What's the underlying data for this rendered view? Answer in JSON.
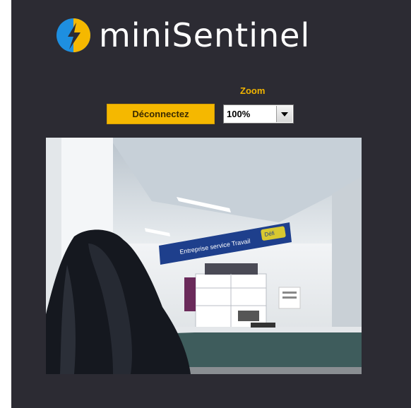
{
  "app": {
    "name": "miniSentinel"
  },
  "controls": {
    "disconnect_label": "Déconnectez",
    "zoom_label": "Zoom",
    "zoom_value": "100%"
  },
  "camera_view": {
    "sign_text": "Entreprise service Travail",
    "sign_badge": "Défi"
  },
  "colors": {
    "background": "#2c2b33",
    "accent": "#f5b800",
    "logo_blue": "#1e8fe0"
  }
}
